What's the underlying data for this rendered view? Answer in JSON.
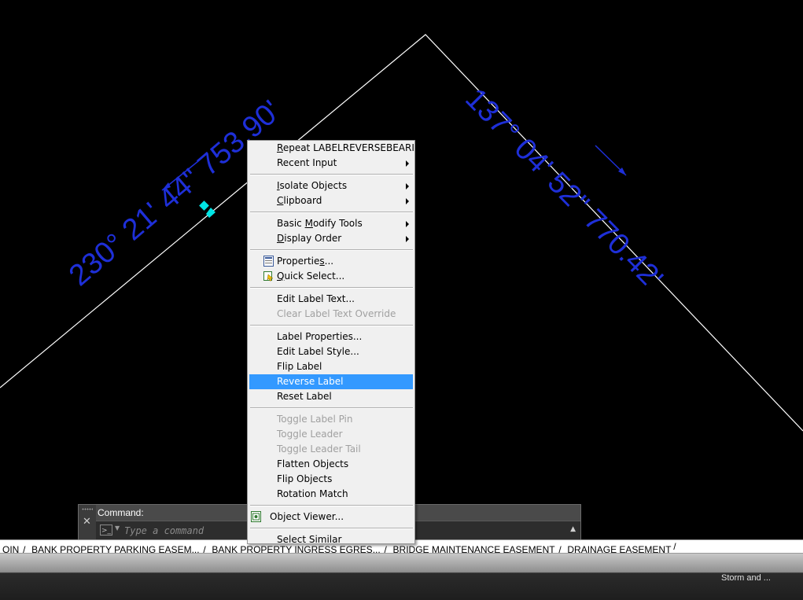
{
  "drawing": {
    "left_label": "230° 21' 44\" 753.90'",
    "right_label": "137° 04' 52\" 770.42'",
    "colors": {
      "label": "#1e2fd8",
      "linework": "#ffffff",
      "grip": "#00e5e5",
      "background": "#000000"
    }
  },
  "command_line": {
    "history": "Command:",
    "placeholder": "Type a command",
    "close_icon": "close-icon",
    "input_icon": "command-prompt-icon"
  },
  "layout_tabs": [
    "OIN",
    "BANK PROPERTY PARKING EASEM...",
    "BANK PROPERTY INGRESS EGRES...",
    "BRIDGE MAINTENANCE EASEMENT",
    "DRAINAGE EASEMENT"
  ],
  "status_bar": {
    "text": "Storm and ..."
  },
  "context_menu": {
    "highlight_color": "#3399ff",
    "groups": [
      [
        {
          "label": "Repeat LABELREVERSEBEARING",
          "underline": "R",
          "submenu": false,
          "enabled": true
        },
        {
          "label": "Recent Input",
          "submenu": true,
          "enabled": true
        }
      ],
      [
        {
          "label": "Isolate Objects",
          "underline": "I",
          "submenu": true,
          "enabled": true
        },
        {
          "label": "Clipboard",
          "underline": "C",
          "submenu": true,
          "enabled": true
        }
      ],
      [
        {
          "label": "Basic Modify Tools",
          "underline": "M",
          "submenu": true,
          "enabled": true
        },
        {
          "label": "Display Order",
          "underline": "D",
          "submenu": true,
          "enabled": true
        }
      ],
      [
        {
          "label": "Properties...",
          "underline": "s",
          "icon": "properties-icon",
          "enabled": true
        },
        {
          "label": "Quick Select...",
          "underline": "Q",
          "icon": "quick-select-icon",
          "enabled": true
        }
      ],
      [
        {
          "label": "Edit Label Text...",
          "enabled": true
        },
        {
          "label": "Clear Label Text Override",
          "enabled": false
        }
      ],
      [
        {
          "label": "Label Properties...",
          "enabled": true
        },
        {
          "label": "Edit Label Style...",
          "enabled": true
        },
        {
          "label": "Flip Label",
          "enabled": true
        },
        {
          "label": "Reverse Label",
          "enabled": true,
          "active": true
        },
        {
          "label": "Reset Label",
          "enabled": true
        }
      ],
      [
        {
          "label": "Toggle Label Pin",
          "enabled": false
        },
        {
          "label": "Toggle Leader",
          "enabled": false
        },
        {
          "label": "Toggle Leader Tail",
          "enabled": false
        },
        {
          "label": "Flatten Objects",
          "enabled": true
        },
        {
          "label": "Flip Objects",
          "enabled": true
        },
        {
          "label": "Rotation Match",
          "enabled": true
        }
      ],
      [
        {
          "label": "Object Viewer...",
          "icon": "object-viewer-icon",
          "iconShift": true,
          "enabled": true
        }
      ],
      [
        {
          "label": "Select Similar",
          "enabled": true
        }
      ]
    ]
  }
}
